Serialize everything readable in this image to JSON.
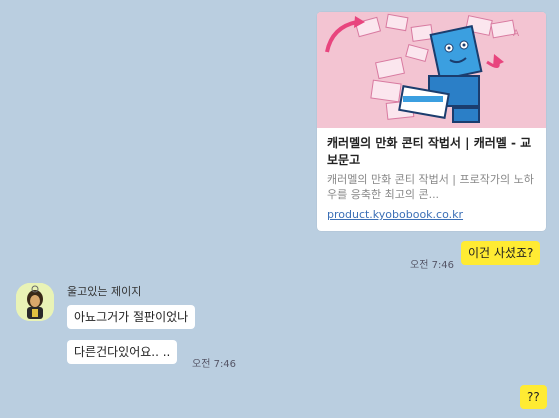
{
  "link_card": {
    "title": "캐러멜의 만화 콘티 작법서 | 캐러멜 - 교보문고",
    "description": "캐러멜의 만화 콘티 작법서 | 프로작가의 노하우를 응축한 최고의 콘...",
    "url": "product.kyobobook.co.kr"
  },
  "messages": {
    "me_1": {
      "text": "이건 사셨죠?",
      "time": "오전 7:46"
    },
    "sender_name": "울고있는 제이지",
    "other_1": {
      "text": "아뇨그거가 절판이었나"
    },
    "other_2": {
      "text": "다른건다있어요.. ..",
      "time": "오전 7:46"
    },
    "me_2": {
      "text": "??"
    }
  }
}
